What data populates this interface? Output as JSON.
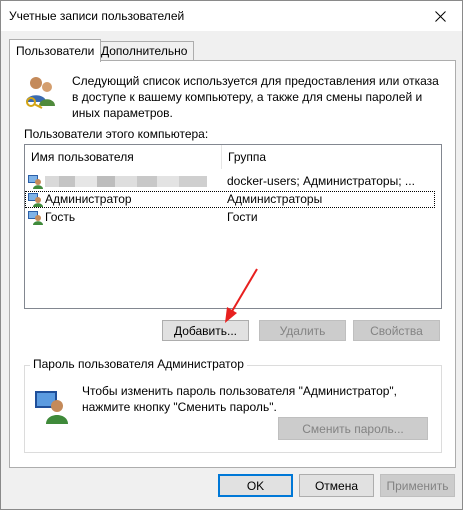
{
  "window": {
    "title": "Учетные записи пользователей"
  },
  "tabs": [
    {
      "label": "Пользователи",
      "active": true
    },
    {
      "label": "Дополнительно",
      "active": false
    }
  ],
  "intro": {
    "text": "Следующий список используется для предоставления или отказа в доступе к вашему компьютеру, а также для смены паролей и иных параметров."
  },
  "users": {
    "label": "Пользователи этого компьютера:",
    "columns": [
      "Имя пользователя",
      "Группа"
    ],
    "rows": [
      {
        "name": "",
        "name_hidden": true,
        "group": "docker-users; Администраторы; ..."
      },
      {
        "name": "Администратор",
        "group": "Администраторы",
        "focused": true
      },
      {
        "name": "Гость",
        "group": "Гости"
      }
    ]
  },
  "buttons": {
    "add": "Добавить...",
    "remove": "Удалить",
    "properties": "Свойства",
    "reset_password": "Сменить пароль...",
    "ok": "OK",
    "cancel": "Отмена",
    "apply": "Применить"
  },
  "password": {
    "title": "Пароль пользователя Администратор",
    "text": "Чтобы изменить пароль пользователя \"Администратор\", нажмите кнопку \"Сменить пароль\"."
  },
  "colors": {
    "accent": "#0078d7",
    "annotation": "#e8201f"
  },
  "icons": [
    "close-icon",
    "users-keys-icon",
    "user-icon",
    "user-password-icon",
    "annotation-arrow"
  ]
}
